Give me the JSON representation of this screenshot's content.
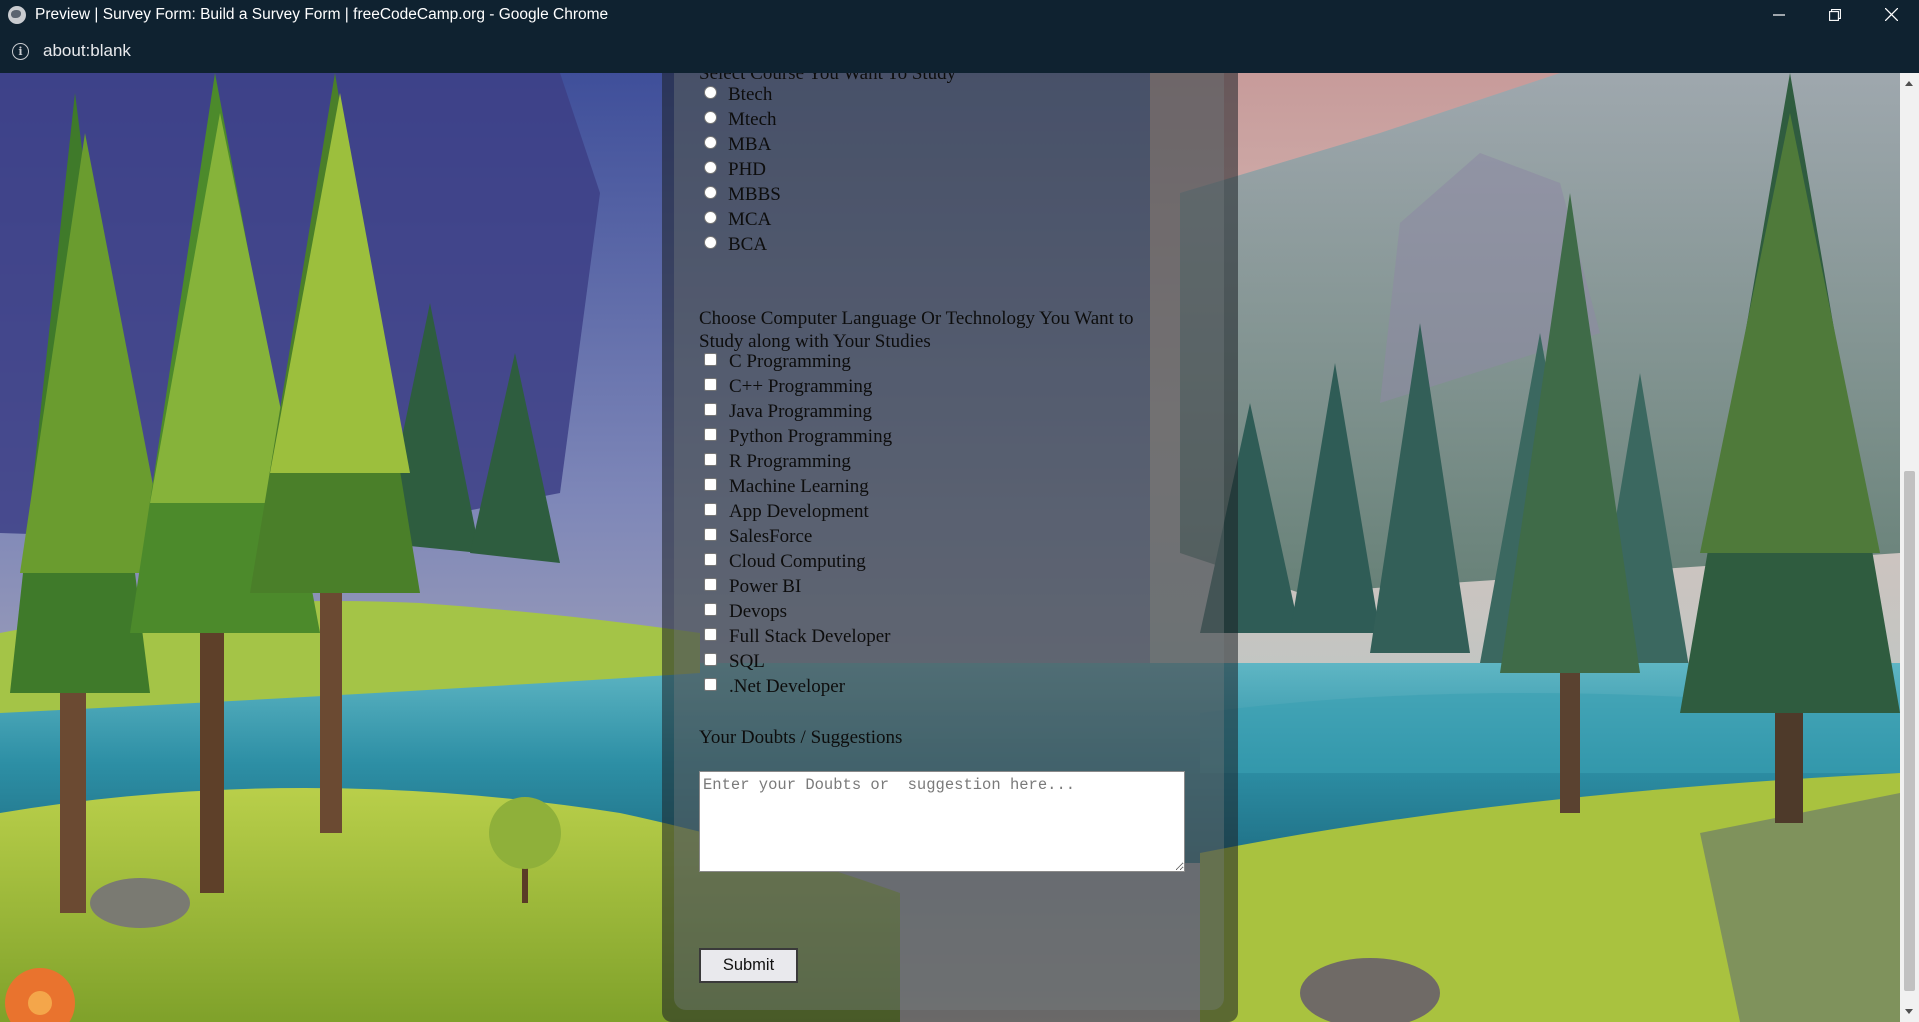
{
  "window": {
    "title": "Preview | Survey Form: Build a Survey Form | freeCodeCamp.org - Google Chrome",
    "url": "about:blank"
  },
  "form": {
    "course_legend": "Select Course You Want To Study",
    "courses": [
      "Btech",
      "Mtech",
      "MBA",
      "PHD",
      "MBBS",
      "MCA",
      "BCA"
    ],
    "tech_legend_line1": "Choose Computer Language Or Technology You Want to",
    "tech_legend_line2": "Study along with Your Studies",
    "technologies": [
      "C Programming",
      "C++ Programming",
      "Java Programming",
      "Python Programming",
      "R Programming",
      "Machine Learning",
      "App Development",
      "SalesForce",
      "Cloud Computing",
      "Power BI",
      "Devops",
      "Full Stack Developer",
      "SQL",
      ".Net Developer"
    ],
    "doubts_label": "Your Doubts / Suggestions",
    "doubts_placeholder": "Enter your Doubts or  suggestion here...",
    "doubts_value": "",
    "submit_label": "Submit"
  },
  "colors": {
    "chrome_bg": "#0f2230",
    "panel_overlay": "rgba(28,32,38,0.55)",
    "text": "#0d0d0d"
  },
  "icons": {
    "favicon": "globe-icon",
    "site_info": "info-icon",
    "minimize": "minimize-icon",
    "restore": "restore-icon",
    "close": "close-icon"
  }
}
